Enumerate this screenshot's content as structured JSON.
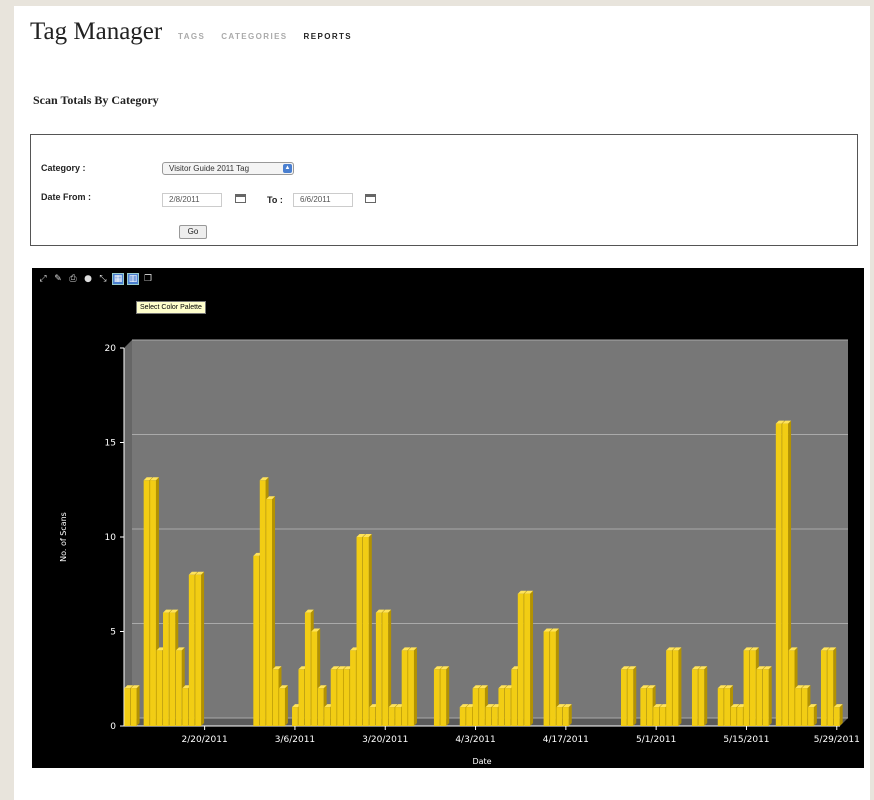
{
  "header": {
    "title": "Tag Manager",
    "nav": [
      {
        "label": "TAGS",
        "active": false
      },
      {
        "label": "CATEGORIES",
        "active": false
      },
      {
        "label": "REPORTS",
        "active": true
      }
    ]
  },
  "page_title": "Scan Totals By Category",
  "filters": {
    "category_label": "Category :",
    "category_value": "Visitor Guide 2011 Tag",
    "date_from_label": "Date From :",
    "date_from_value": "2/8/2011",
    "to_label": "To :",
    "to_value": "6/6/2011",
    "go_label": "Go"
  },
  "chart_toolbar": {
    "icons": [
      "zoom-icon",
      "pan-icon",
      "print-icon",
      "save-icon",
      "expand-icon",
      "color-palette-icon",
      "chart-type-icon",
      "copy-icon"
    ],
    "tooltip": "Select Color Palette"
  },
  "chart_data": {
    "type": "bar",
    "xlabel": "Date",
    "ylabel": "No. of Scans",
    "ylim": [
      0,
      20
    ],
    "yticks": [
      0,
      5,
      10,
      15,
      20
    ],
    "xticks": [
      "2/20/2011",
      "3/6/2011",
      "3/20/2011",
      "4/3/2011",
      "4/17/2011",
      "5/1/2011",
      "5/15/2011",
      "5/29/2011"
    ],
    "grid": true,
    "colors": {
      "bar": "#f2cd14",
      "bar_side": "#b39200",
      "plot_bg": "#777777",
      "panel_bg": "#000000",
      "axis": "#ffffff"
    },
    "categories": [
      "2/8/2011",
      "2/9/2011",
      "2/10/2011",
      "2/11/2011",
      "2/12/2011",
      "2/13/2011",
      "2/14/2011",
      "2/15/2011",
      "2/16/2011",
      "2/17/2011",
      "2/18/2011",
      "2/19/2011",
      "2/20/2011",
      "2/21/2011",
      "2/22/2011",
      "2/23/2011",
      "2/24/2011",
      "2/25/2011",
      "2/26/2011",
      "2/27/2011",
      "2/28/2011",
      "3/1/2011",
      "3/2/2011",
      "3/3/2011",
      "3/4/2011",
      "3/5/2011",
      "3/6/2011",
      "3/7/2011",
      "3/8/2011",
      "3/9/2011",
      "3/10/2011",
      "3/11/2011",
      "3/12/2011",
      "3/13/2011",
      "3/14/2011",
      "3/15/2011",
      "3/16/2011",
      "3/17/2011",
      "3/18/2011",
      "3/19/2011",
      "3/20/2011",
      "3/21/2011",
      "3/22/2011",
      "3/23/2011",
      "3/24/2011",
      "3/25/2011",
      "3/26/2011",
      "3/27/2011",
      "3/28/2011",
      "3/29/2011",
      "3/30/2011",
      "3/31/2011",
      "4/1/2011",
      "4/2/2011",
      "4/3/2011",
      "4/4/2011",
      "4/5/2011",
      "4/6/2011",
      "4/7/2011",
      "4/8/2011",
      "4/9/2011",
      "4/10/2011",
      "4/11/2011",
      "4/12/2011",
      "4/13/2011",
      "4/14/2011",
      "4/15/2011",
      "4/16/2011",
      "4/17/2011",
      "4/18/2011",
      "4/19/2011",
      "4/20/2011",
      "4/21/2011",
      "4/22/2011",
      "4/23/2011",
      "4/24/2011",
      "4/25/2011",
      "4/26/2011",
      "4/27/2011",
      "4/28/2011",
      "4/29/2011",
      "4/30/2011",
      "5/1/2011",
      "5/2/2011",
      "5/3/2011",
      "5/4/2011",
      "5/5/2011",
      "5/6/2011",
      "5/7/2011",
      "5/8/2011",
      "5/9/2011",
      "5/10/2011",
      "5/11/2011",
      "5/12/2011",
      "5/13/2011",
      "5/14/2011",
      "5/15/2011",
      "5/16/2011",
      "5/17/2011",
      "5/18/2011",
      "5/19/2011",
      "5/20/2011",
      "5/21/2011",
      "5/22/2011",
      "5/23/2011",
      "5/24/2011",
      "5/25/2011",
      "5/26/2011",
      "5/27/2011",
      "5/28/2011",
      "5/29/2011",
      "5/30/2011",
      "5/31/2011",
      "6/1/2011",
      "6/2/2011",
      "6/3/2011",
      "6/4/2011",
      "6/5/2011",
      "6/6/2011"
    ],
    "values": [
      2,
      2,
      0,
      13,
      13,
      4,
      6,
      6,
      4,
      2,
      8,
      8,
      0,
      0,
      0,
      0,
      0,
      0,
      0,
      0,
      9,
      13,
      12,
      3,
      2,
      0,
      1,
      3,
      6,
      5,
      2,
      1,
      3,
      3,
      3,
      4,
      10,
      10,
      1,
      6,
      6,
      1,
      1,
      4,
      4,
      0,
      0,
      0,
      3,
      3,
      0,
      0,
      1,
      1,
      2,
      2,
      1,
      1,
      2,
      2,
      3,
      7,
      7,
      0,
      0,
      5,
      5,
      1,
      1,
      0,
      0,
      0,
      0,
      0,
      0,
      0,
      0,
      3,
      3,
      0,
      2,
      2,
      1,
      1,
      4,
      4,
      0,
      0,
      3,
      3,
      0,
      0,
      2,
      2,
      1,
      1,
      4,
      4,
      3,
      3,
      0,
      16,
      16,
      4,
      2,
      2,
      1,
      0,
      4,
      4,
      1
    ]
  }
}
